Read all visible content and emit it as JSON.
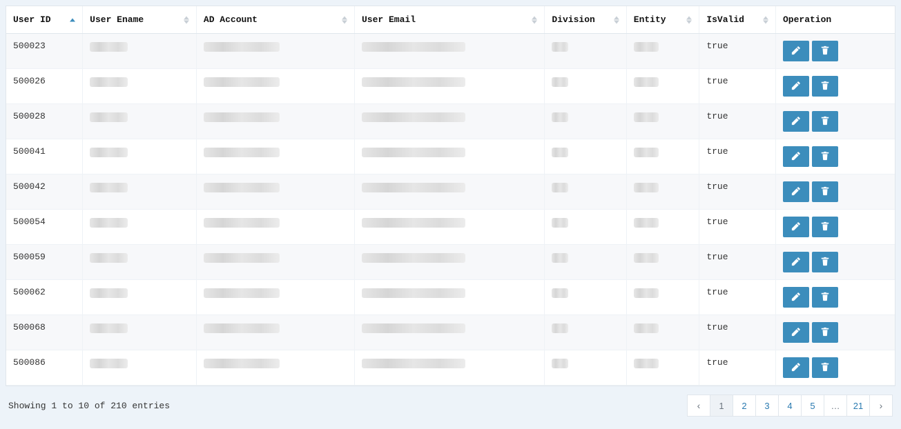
{
  "columns": [
    {
      "key": "user_id",
      "label": "User ID",
      "sortable": true,
      "sort": "asc"
    },
    {
      "key": "user_ename",
      "label": "User Ename",
      "sortable": true
    },
    {
      "key": "ad_account",
      "label": "AD Account",
      "sortable": true
    },
    {
      "key": "user_email",
      "label": "User Email",
      "sortable": true
    },
    {
      "key": "division",
      "label": "Division",
      "sortable": true
    },
    {
      "key": "entity",
      "label": "Entity",
      "sortable": true
    },
    {
      "key": "is_valid",
      "label": "IsValid",
      "sortable": true
    },
    {
      "key": "operation",
      "label": "Operation",
      "sortable": false
    }
  ],
  "rows": [
    {
      "user_id": "500023",
      "is_valid": "true"
    },
    {
      "user_id": "500026",
      "is_valid": "true"
    },
    {
      "user_id": "500028",
      "is_valid": "true"
    },
    {
      "user_id": "500041",
      "is_valid": "true"
    },
    {
      "user_id": "500042",
      "is_valid": "true"
    },
    {
      "user_id": "500054",
      "is_valid": "true"
    },
    {
      "user_id": "500059",
      "is_valid": "true"
    },
    {
      "user_id": "500062",
      "is_valid": "true"
    },
    {
      "user_id": "500068",
      "is_valid": "true"
    },
    {
      "user_id": "500086",
      "is_valid": "true"
    }
  ],
  "footer": {
    "info": "Showing 1 to 10 of 210 entries"
  },
  "pagination": {
    "prev": "‹",
    "next": "›",
    "ellipsis": "…",
    "pages": [
      "1",
      "2",
      "3",
      "4",
      "5"
    ],
    "last": "21",
    "active": "1"
  },
  "icons": {
    "edit": "edit-icon",
    "delete": "trash-icon"
  },
  "colors": {
    "accent": "#3c8dbc",
    "row_alt": "#f7f8fa"
  }
}
